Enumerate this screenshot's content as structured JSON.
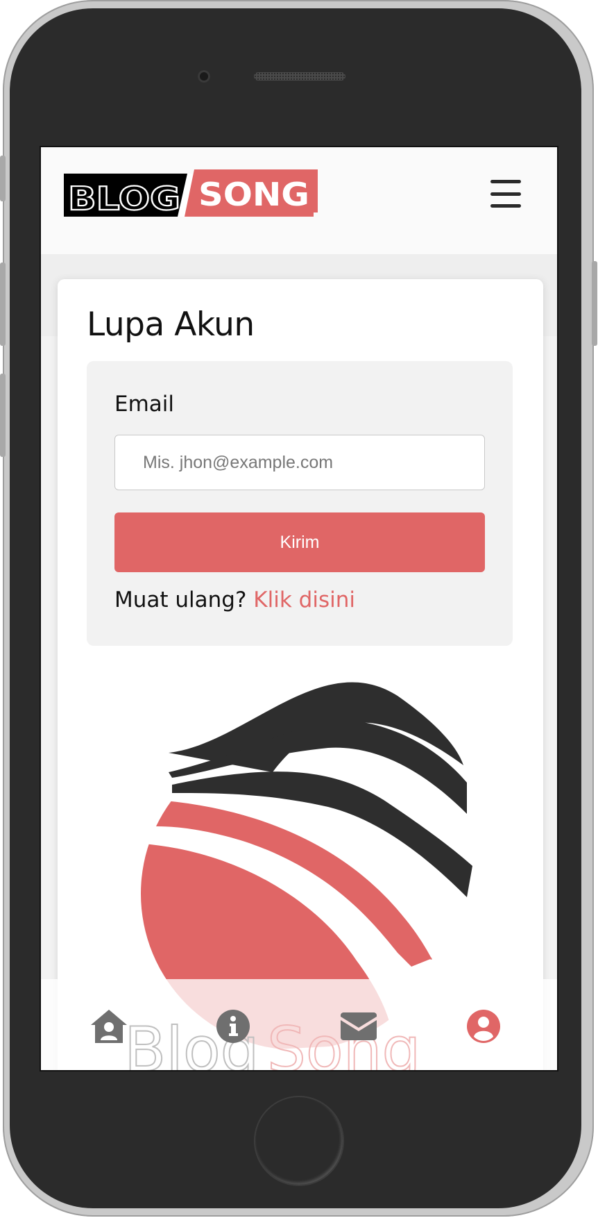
{
  "brand": {
    "logo_left": "BLOG",
    "logo_right": "SONG",
    "watermark_left": "Blog",
    "watermark_right": "Song"
  },
  "page": {
    "title": "Lupa Akun"
  },
  "form": {
    "email_label": "Email",
    "email_placeholder": "Mis. jhon@example.com",
    "email_value": "",
    "submit_label": "Kirim",
    "reload_text": "Muat ulang?",
    "reload_link": "Klik disini"
  },
  "bottom_nav": {
    "items": [
      {
        "icon": "home-user-icon",
        "active": false
      },
      {
        "icon": "info-icon",
        "active": false
      },
      {
        "icon": "envelope-icon",
        "active": false
      },
      {
        "icon": "user-circle-icon",
        "active": true
      }
    ]
  },
  "colors": {
    "accent": "#e06666",
    "dark": "#2e2e2e",
    "inactive_icon": "#6f6f6f"
  }
}
